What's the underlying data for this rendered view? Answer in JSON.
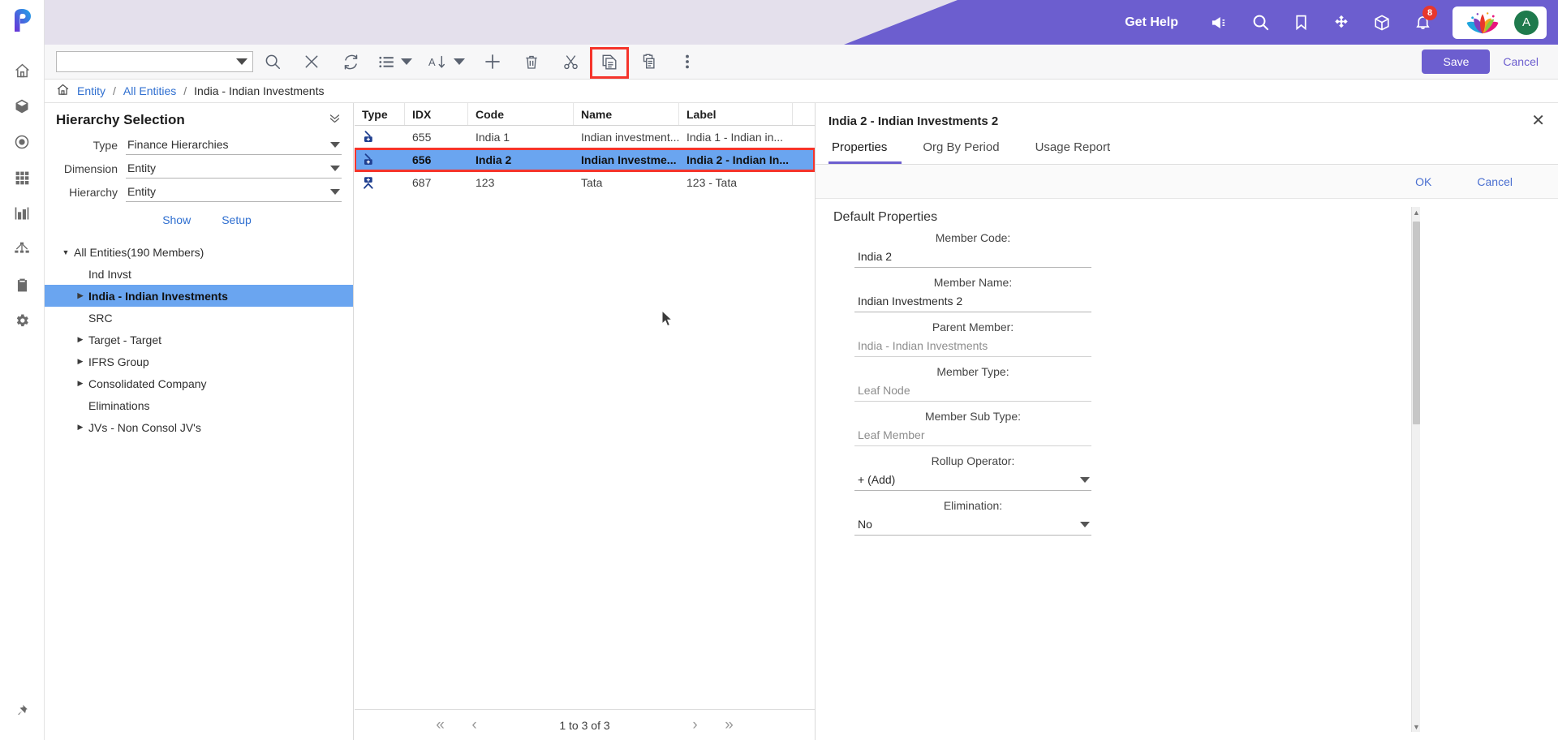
{
  "header": {
    "get_help": "Get Help",
    "icons": [
      "megaphone-icon",
      "search-icon",
      "bookmark-icon",
      "puzzle-icon",
      "box-icon",
      "bell-icon"
    ],
    "notification_count": "8",
    "avatar_initial": "A",
    "brand_color": "#6c5ecf"
  },
  "rail": {
    "icons": [
      "home-icon",
      "cube-icon",
      "target-icon",
      "grid-icon",
      "chart-icon",
      "hierarchy-icon",
      "clipboard-icon",
      "gear-icon",
      "pin-icon"
    ]
  },
  "toolbar": {
    "search_value": "",
    "icons": [
      "search-icon",
      "close-icon",
      "refresh-icon",
      "list-icon",
      "sort-icon",
      "add-icon",
      "delete-icon",
      "cut-icon",
      "copy-icon",
      "paste-icon",
      "more-icon"
    ],
    "save_label": "Save",
    "cancel_label": "Cancel",
    "highlighted_button": "copy-icon"
  },
  "breadcrumb": {
    "items": [
      "Entity",
      "All Entities",
      "India - Indian Investments"
    ],
    "separator": "/"
  },
  "hierarchy_panel": {
    "title": "Hierarchy Selection",
    "fields": [
      {
        "label": "Type",
        "value": "Finance Hierarchies"
      },
      {
        "label": "Dimension",
        "value": "Entity"
      },
      {
        "label": "Hierarchy",
        "value": "Entity"
      }
    ],
    "links": [
      "Show",
      "Setup"
    ],
    "tree": [
      {
        "label": "All Entities(190 Members)",
        "level": 0,
        "expanded": true,
        "has_children": true,
        "selected": false
      },
      {
        "label": "Ind Invst",
        "level": 1,
        "expanded": false,
        "has_children": false,
        "selected": false
      },
      {
        "label": "India - Indian Investments",
        "level": 1,
        "expanded": false,
        "has_children": true,
        "selected": true
      },
      {
        "label": "SRC",
        "level": 1,
        "expanded": false,
        "has_children": false,
        "selected": false
      },
      {
        "label": "Target - Target",
        "level": 1,
        "expanded": false,
        "has_children": true,
        "selected": false
      },
      {
        "label": "IFRS Group",
        "level": 1,
        "expanded": false,
        "has_children": true,
        "selected": false
      },
      {
        "label": "Consolidated Company",
        "level": 1,
        "expanded": false,
        "has_children": true,
        "selected": false
      },
      {
        "label": "Eliminations",
        "level": 1,
        "expanded": false,
        "has_children": false,
        "selected": false
      },
      {
        "label": "JVs - Non Consol JV's",
        "level": 1,
        "expanded": false,
        "has_children": true,
        "selected": false
      }
    ]
  },
  "grid": {
    "columns": [
      "Type",
      "IDX",
      "Code",
      "Name",
      "Label"
    ],
    "rows": [
      {
        "type_icon": "leaf-node-icon",
        "idx": "655",
        "code": "India 1",
        "name": "Indian investment...",
        "label": "India 1 - Indian in...",
        "selected": false
      },
      {
        "type_icon": "leaf-node-icon",
        "idx": "656",
        "code": "India 2",
        "name": "Indian Investme...",
        "label": "India 2 - Indian In...",
        "selected": true
      },
      {
        "type_icon": "parent-node-icon",
        "idx": "687",
        "code": "123",
        "name": "Tata",
        "label": "123 - Tata",
        "selected": false
      }
    ],
    "pagination": {
      "info": "1 to 3 of 3",
      "first": "«",
      "prev": "‹",
      "next": "›",
      "last": "»"
    }
  },
  "properties_panel": {
    "title": "India 2 - Indian Investments 2",
    "tabs": [
      {
        "label": "Properties",
        "active": true
      },
      {
        "label": "Org By Period",
        "active": false
      },
      {
        "label": "Usage Report",
        "active": false
      }
    ],
    "ok_label": "OK",
    "cancel_label": "Cancel",
    "section_title": "Default Properties",
    "fields": [
      {
        "label": "Member Code:",
        "value": "India 2",
        "readonly": false,
        "dropdown": false
      },
      {
        "label": "Member Name:",
        "value": "Indian Investments 2",
        "readonly": false,
        "dropdown": false
      },
      {
        "label": "Parent Member:",
        "value": "India - Indian Investments",
        "readonly": true,
        "dropdown": false
      },
      {
        "label": "Member Type:",
        "value": "Leaf Node",
        "readonly": true,
        "dropdown": false
      },
      {
        "label": "Member Sub Type:",
        "value": "Leaf Member",
        "readonly": true,
        "dropdown": false
      },
      {
        "label": "Rollup Operator:",
        "value": "+ (Add)",
        "readonly": false,
        "dropdown": true
      },
      {
        "label": "Elimination:",
        "value": "No",
        "readonly": false,
        "dropdown": true
      }
    ]
  }
}
